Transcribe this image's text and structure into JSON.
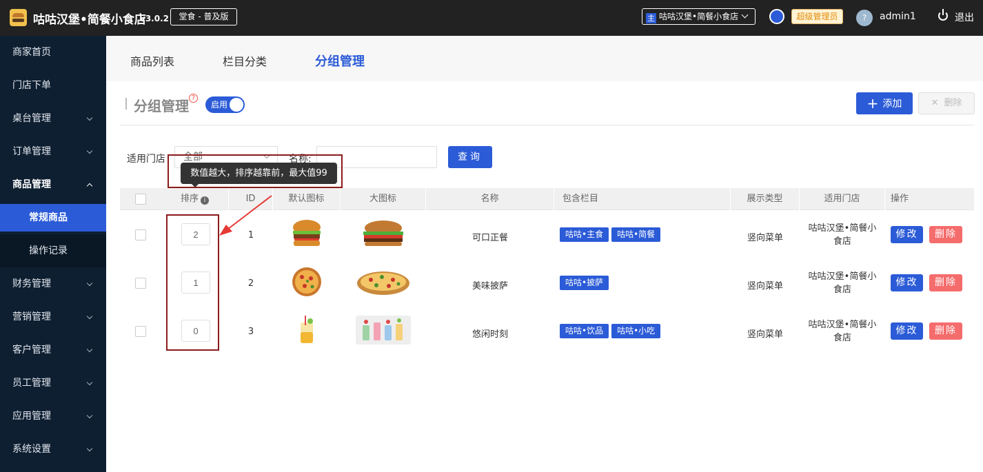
{
  "header": {
    "app_title": "咕咕汉堡•简餐小食店",
    "version": "v3.0.2",
    "edition": "堂食 - 普及版",
    "store_badge": "主",
    "store_name": "咕咕汉堡•简餐小食店",
    "role": "超级管理员",
    "username": "admin1",
    "logout": "退出",
    "accent_color": "#2b5bd7"
  },
  "sidebar": {
    "items": [
      {
        "label": "商家首页"
      },
      {
        "label": "门店下单"
      },
      {
        "label": "桌台管理"
      },
      {
        "label": "订单管理"
      },
      {
        "label": "商品管理"
      },
      {
        "label": "常规商品"
      },
      {
        "label": "操作记录"
      },
      {
        "label": "财务管理"
      },
      {
        "label": "营销管理"
      },
      {
        "label": "客户管理"
      },
      {
        "label": "员工管理"
      },
      {
        "label": "应用管理"
      },
      {
        "label": "系统设置"
      }
    ]
  },
  "tabs": [
    {
      "label": "商品列表"
    },
    {
      "label": "栏目分类"
    },
    {
      "label": "分组管理"
    }
  ],
  "section": {
    "title": "分组管理",
    "help_mark": "?",
    "toggle_label": "启用",
    "add_label": "添加",
    "delete_label": "删除"
  },
  "filters": {
    "store_label": "适用门店",
    "store_value": "全部",
    "name_label": "名称:",
    "name_value": "",
    "query_label": "查询"
  },
  "tooltip": "数值越大，排序越靠前，最大值99",
  "table": {
    "columns": [
      "排序",
      "ID",
      "默认图标",
      "大图标",
      "名称",
      "包含栏目",
      "展示类型",
      "适用门店",
      "操作"
    ],
    "edit_label": "修改",
    "remove_label": "删除",
    "rows": [
      {
        "sort": "2",
        "id": "1",
        "name": "可口正餐",
        "categories": [
          "咕咕•主食",
          "咕咕•简餐"
        ],
        "display_type": "竖向菜单",
        "store": "咕咕汉堡•简餐小食店",
        "icon": "burger-icon",
        "big_icon": "burger-image"
      },
      {
        "sort": "1",
        "id": "2",
        "name": "美味披萨",
        "categories": [
          "咕咕•披萨"
        ],
        "display_type": "竖向菜单",
        "store": "咕咕汉堡•简餐小食店",
        "icon": "pizza-icon",
        "big_icon": "pizza-image"
      },
      {
        "sort": "0",
        "id": "3",
        "name": "悠闲时刻",
        "categories": [
          "咕咕•饮品",
          "咕咕•小吃"
        ],
        "display_type": "竖向菜单",
        "store": "咕咕汉堡•简餐小食店",
        "icon": "drink-icon",
        "big_icon": "drinks-image"
      }
    ]
  }
}
